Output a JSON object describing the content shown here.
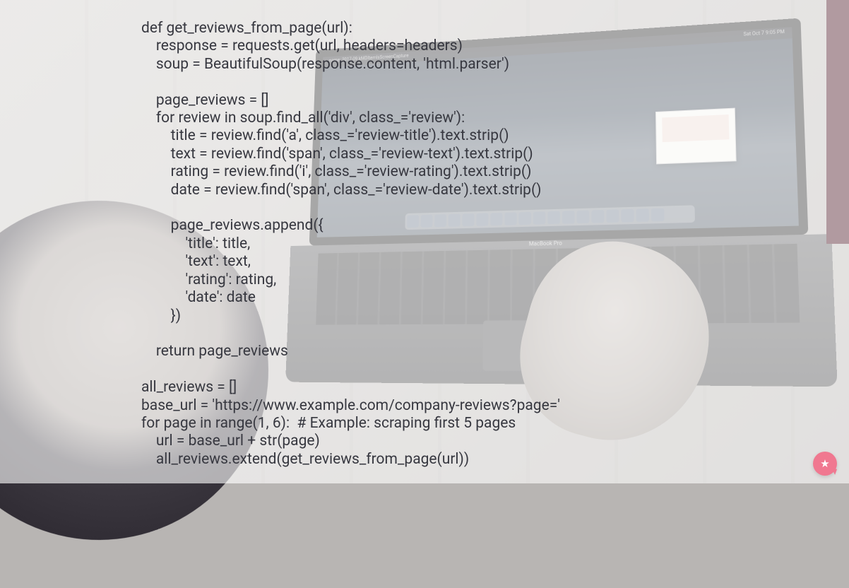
{
  "menubar": {
    "left": "name: 2017-09 kMDItemIsScreenCapture",
    "right_time": "Sat Oct 7  9:05 PM"
  },
  "laptop_label": "MacBook Pro",
  "code": {
    "lines": [
      "def get_reviews_from_page(url):",
      "    response = requests.get(url, headers=headers)",
      "    soup = BeautifulSoup(response.content, 'html.parser')",
      "",
      "    page_reviews = []",
      "    for review in soup.find_all('div', class_='review'):",
      "        title = review.find('a', class_='review-title').text.strip()",
      "        text = review.find('span', class_='review-text').text.strip()",
      "        rating = review.find('i', class_='review-rating').text.strip()",
      "        date = review.find('span', class_='review-date').text.strip()",
      "",
      "        page_reviews.append({",
      "            'title': title,",
      "            'text': text,",
      "            'rating': rating,",
      "            'date': date",
      "        })",
      "",
      "    return page_reviews",
      "",
      "all_reviews = []",
      "base_url = 'https://www.example.com/company-reviews?page='",
      "for page in range(1, 6):  # Example: scraping first 5 pages",
      "    url = base_url + str(page)",
      "    all_reviews.extend(get_reviews_from_page(url))"
    ]
  },
  "fab_icon_glyph": "★"
}
